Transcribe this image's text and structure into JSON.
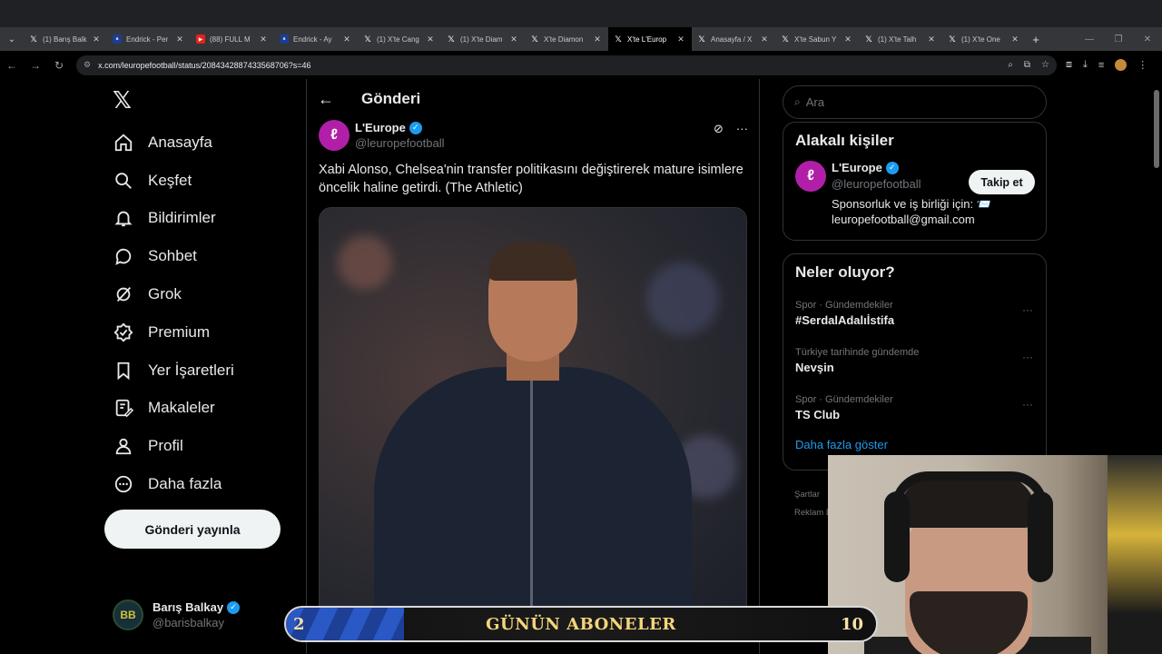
{
  "browser": {
    "tabs": [
      {
        "title": "(1) Barış Balk",
        "icon": "x-icon"
      },
      {
        "title": "Endrick - Per",
        "icon": "site-icon"
      },
      {
        "title": "(88) FULL M",
        "icon": "youtube-icon"
      },
      {
        "title": "Endrick - Ay",
        "icon": "site-icon"
      },
      {
        "title": "(1) X'te Cang",
        "icon": "x-icon"
      },
      {
        "title": "(1) X'te Diam",
        "icon": "x-icon"
      },
      {
        "title": "X'te Diamon",
        "icon": "x-icon"
      },
      {
        "title": "X'te L'Europ",
        "icon": "x-icon",
        "active": true
      },
      {
        "title": "Anasayfa / X",
        "icon": "x-icon"
      },
      {
        "title": "X'te Sabun Y",
        "icon": "x-icon"
      },
      {
        "title": "(1) X'te Talh",
        "icon": "x-icon"
      },
      {
        "title": "(1) X'te One",
        "icon": "x-icon"
      }
    ],
    "url": "x.com/leuropefootball/status/2084342887433568706?s=46"
  },
  "sidebar": {
    "logo": "𝕏",
    "items": [
      {
        "label": "Anasayfa",
        "icon": "home-icon"
      },
      {
        "label": "Keşfet",
        "icon": "search-icon"
      },
      {
        "label": "Bildirimler",
        "icon": "bell-icon"
      },
      {
        "label": "Sohbet",
        "icon": "chat-icon"
      },
      {
        "label": "Grok",
        "icon": "grok-icon"
      },
      {
        "label": "Premium",
        "icon": "premium-icon"
      },
      {
        "label": "Yer İşaretleri",
        "icon": "bookmark-icon"
      },
      {
        "label": "Makaleler",
        "icon": "articles-icon"
      },
      {
        "label": "Profil",
        "icon": "profile-icon"
      },
      {
        "label": "Daha fazla",
        "icon": "more-icon"
      }
    ],
    "post_button": "Gönderi yayınla",
    "account": {
      "name": "Barış Balkay",
      "handle": "@barisbalkay",
      "initials": "BB"
    }
  },
  "main": {
    "header_title": "Gönderi",
    "post": {
      "author_name": "L'Europe",
      "author_handle": "@leuropefootball",
      "text": "Xabi Alonso, Chelsea'nin transfer politikasını değiştirerek mature isimlere öncelik haline getirdi. (The Athletic)"
    }
  },
  "right": {
    "search_placeholder": "Ara",
    "related": {
      "title": "Alakalı kişiler",
      "name": "L'Europe",
      "handle": "@leuropefootball",
      "bio": "Sponsorluk ve iş birliği için: 📨 leuropefootball@gmail.com",
      "follow_label": "Takip et"
    },
    "trends": {
      "title": "Neler oluyor?",
      "items": [
        {
          "context": "Spor · Gündemdekiler",
          "topic": "#SerdalAdalıİstifa"
        },
        {
          "context": "Türkiye tarihinde gündemde",
          "topic": "Nevşin"
        },
        {
          "context": "Spor · Gündemdekiler",
          "topic": "TS Club"
        }
      ],
      "show_more": "Daha fazla göster"
    },
    "footer": [
      "Şartlar",
      "Reklam B"
    ]
  },
  "overlay": {
    "banner_label": "GÜNÜN ABONELER",
    "banner_left_number": "2",
    "banner_right_number": "10",
    "banner_progress": 0.2
  }
}
